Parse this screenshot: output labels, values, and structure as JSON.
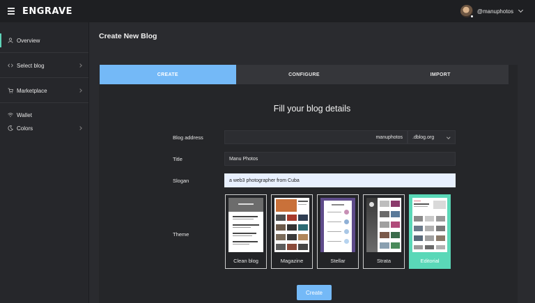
{
  "header": {
    "logo_text": "ENGRAVE",
    "username": "@manuphotos"
  },
  "sidebar": {
    "items": [
      {
        "label": "Overview",
        "icon": "user-icon"
      },
      {
        "label": "Select blog",
        "icon": "code-icon"
      },
      {
        "label": "Marketplace",
        "icon": "cart-icon"
      },
      {
        "label": "Wallet",
        "icon": "wifi-icon"
      },
      {
        "label": "Colors",
        "icon": "moon-icon"
      }
    ]
  },
  "main": {
    "title": "Create New Blog",
    "steps": [
      "CREATE",
      "CONFIGURE",
      "IMPORT"
    ],
    "form_title": "Fill your blog details",
    "fields": {
      "blog_address_label": "Blog address",
      "blog_address_value": "manuphotos",
      "domain": ".dblog.org",
      "title_label": "Title",
      "title_value": "Manu Photos",
      "slogan_label": "Slogan",
      "slogan_value": "a web3 photographer from Cuba",
      "theme_label": "Theme"
    },
    "themes": [
      {
        "name": "Clean blog",
        "selected": false
      },
      {
        "name": "Magazine",
        "selected": false
      },
      {
        "name": "Stellar",
        "selected": false
      },
      {
        "name": "Strata",
        "selected": false
      },
      {
        "name": "Editorial",
        "selected": true
      }
    ],
    "create_button": "Create"
  },
  "colors": {
    "accent": "#74b9f7",
    "selected_theme": "#5ad8b8",
    "active_indicator": "#5fd3b8"
  }
}
